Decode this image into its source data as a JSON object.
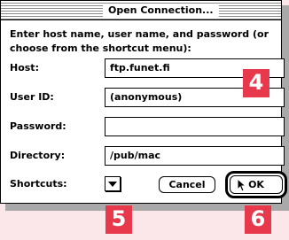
{
  "dialog": {
    "title": "Open Connection...",
    "instructions": "Enter host name, user name, and password (or choose from the shortcut menu):",
    "fields": {
      "host": {
        "label": "Host:",
        "value": "ftp.funet.fi"
      },
      "user_id": {
        "label": "User ID:",
        "value": "(anonymous)"
      },
      "password": {
        "label": "Password:",
        "value": ""
      },
      "directory": {
        "label": "Directory:",
        "value": "/pub/mac"
      }
    },
    "shortcuts": {
      "label": "Shortcuts:",
      "icon": "triangle-down-icon"
    },
    "buttons": {
      "cancel": "Cancel",
      "ok": "OK"
    }
  },
  "callouts": {
    "four": "4",
    "five": "5",
    "six": "6"
  },
  "colors": {
    "callout": "#e8384c",
    "background": "#fbe6ea",
    "shadow": "#a9a9a9"
  }
}
